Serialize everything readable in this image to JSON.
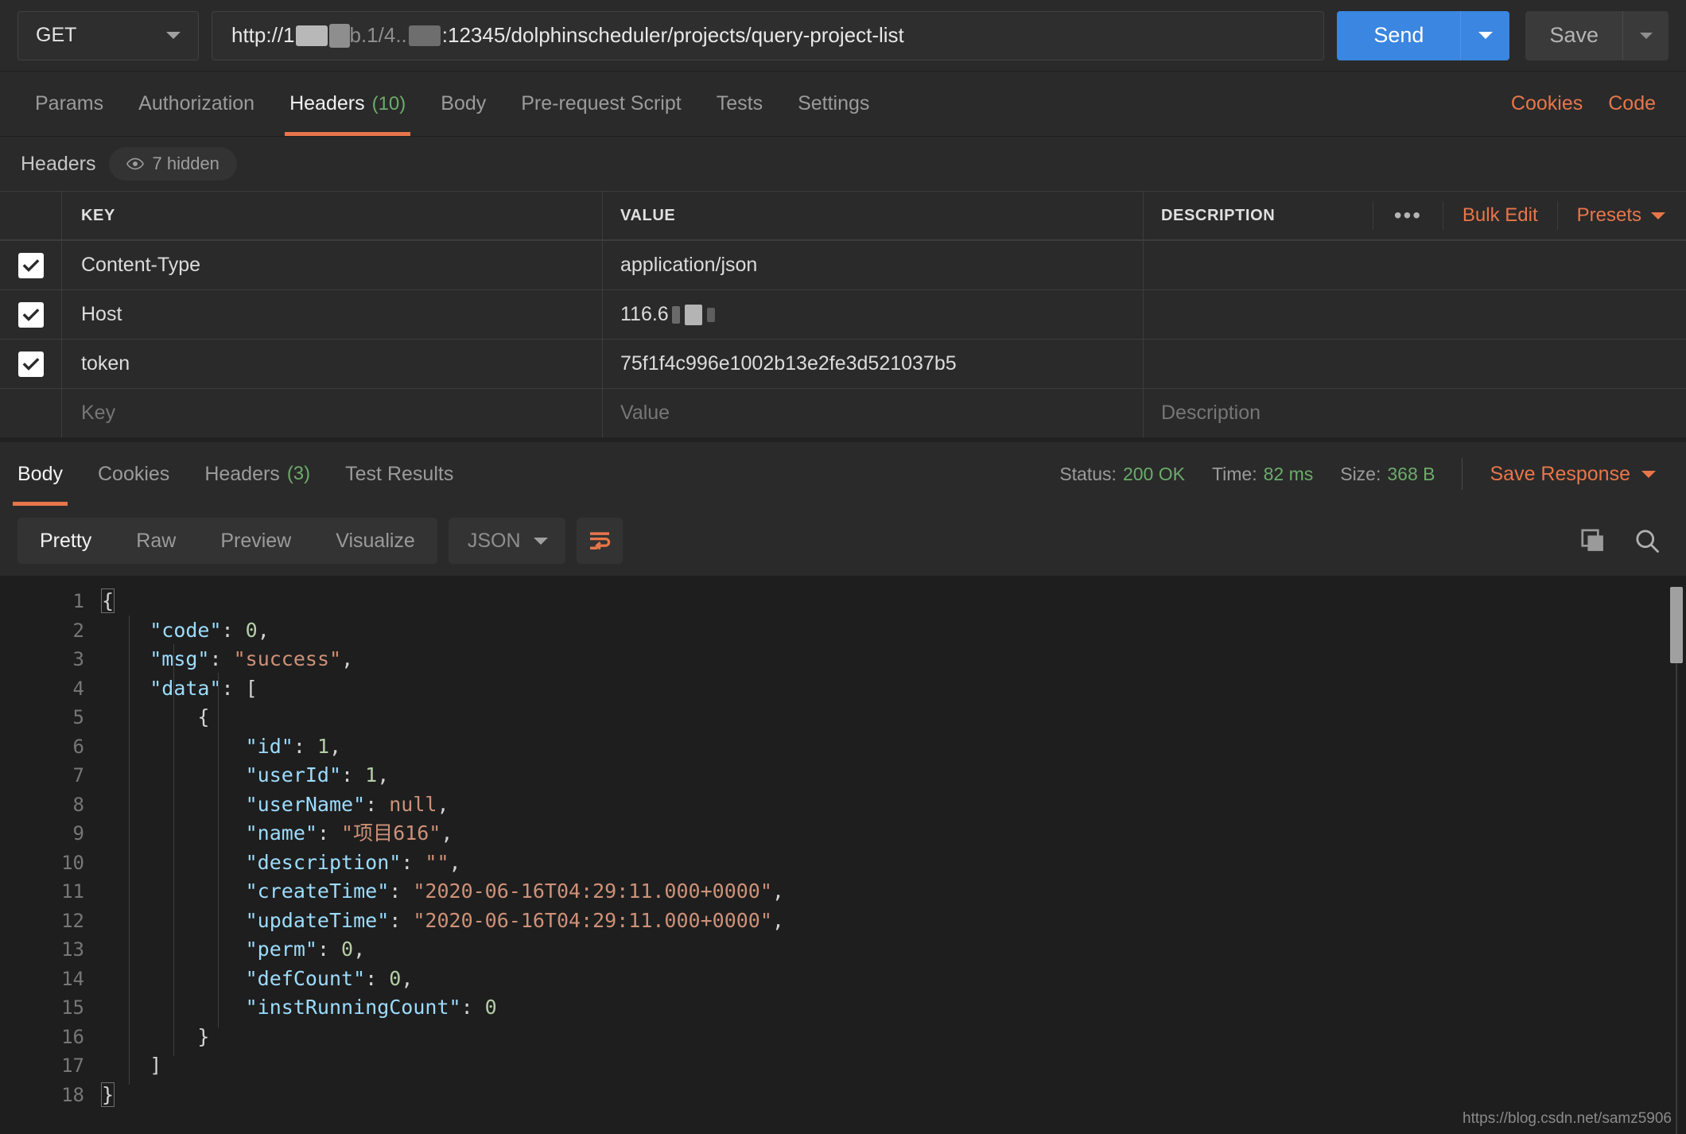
{
  "request": {
    "method": "GET",
    "url_prefix": "http://1",
    "url_suffix": ":12345/dolphinscheduler/projects/query-project-list",
    "send_label": "Send",
    "save_label": "Save"
  },
  "request_tabs": [
    {
      "label": "Params",
      "count": "",
      "active": false
    },
    {
      "label": "Authorization",
      "count": "",
      "active": false
    },
    {
      "label": "Headers",
      "count": "(10)",
      "active": true
    },
    {
      "label": "Body",
      "count": "",
      "active": false
    },
    {
      "label": "Pre-request Script",
      "count": "",
      "active": false
    },
    {
      "label": "Tests",
      "count": "",
      "active": false
    },
    {
      "label": "Settings",
      "count": "",
      "active": false
    }
  ],
  "request_tab_links": [
    {
      "label": "Cookies"
    },
    {
      "label": "Code"
    }
  ],
  "headers_panel": {
    "title": "Headers",
    "hidden_label": "7 hidden",
    "columns": [
      "KEY",
      "VALUE",
      "DESCRIPTION"
    ],
    "tools": {
      "more": "•••",
      "bulk_edit": "Bulk Edit",
      "presets": "Presets"
    },
    "rows": [
      {
        "checked": true,
        "key": "Content-Type",
        "value": "application/json",
        "description": "",
        "redacted": false
      },
      {
        "checked": true,
        "key": "Host",
        "value": "116.6",
        "description": "",
        "redacted": true
      },
      {
        "checked": true,
        "key": "token",
        "value": "75f1f4c996e1002b13e2fe3d521037b5",
        "description": "",
        "redacted": false
      }
    ],
    "new_row": {
      "key_placeholder": "Key",
      "value_placeholder": "Value",
      "description_placeholder": "Description"
    }
  },
  "response_tabs": [
    {
      "label": "Body",
      "count": "",
      "active": true
    },
    {
      "label": "Cookies",
      "count": "",
      "active": false
    },
    {
      "label": "Headers",
      "count": "(3)",
      "active": false
    },
    {
      "label": "Test Results",
      "count": "",
      "active": false
    }
  ],
  "response_meta": {
    "status_label": "Status:",
    "status_value": "200 OK",
    "time_label": "Time:",
    "time_value": "82 ms",
    "size_label": "Size:",
    "size_value": "368 B",
    "save_response": "Save Response"
  },
  "body_toolbar": {
    "modes": [
      {
        "label": "Pretty",
        "active": true
      },
      {
        "label": "Raw",
        "active": false
      },
      {
        "label": "Preview",
        "active": false
      },
      {
        "label": "Visualize",
        "active": false
      }
    ],
    "format": "JSON"
  },
  "response_body": {
    "line_numbers": [
      "1",
      "2",
      "3",
      "4",
      "5",
      "6",
      "7",
      "8",
      "9",
      "10",
      "11",
      "12",
      "13",
      "14",
      "15",
      "16",
      "17",
      "18"
    ],
    "json": {
      "code": 0,
      "msg": "success",
      "data": [
        {
          "id": 1,
          "userId": 1,
          "userName": null,
          "name": "项目616",
          "description": "",
          "createTime": "2020-06-16T04:29:11.000+0000",
          "updateTime": "2020-06-16T04:29:11.000+0000",
          "perm": 0,
          "defCount": 0,
          "instRunningCount": 0
        }
      ]
    }
  },
  "watermark": "https://blog.csdn.net/samz5906",
  "colors": {
    "accent_orange": "#e8764a",
    "send_blue": "#3a86e0",
    "status_green": "#6cab6c",
    "bg": "#2a2a2a",
    "code_bg": "#1e1e1e"
  }
}
